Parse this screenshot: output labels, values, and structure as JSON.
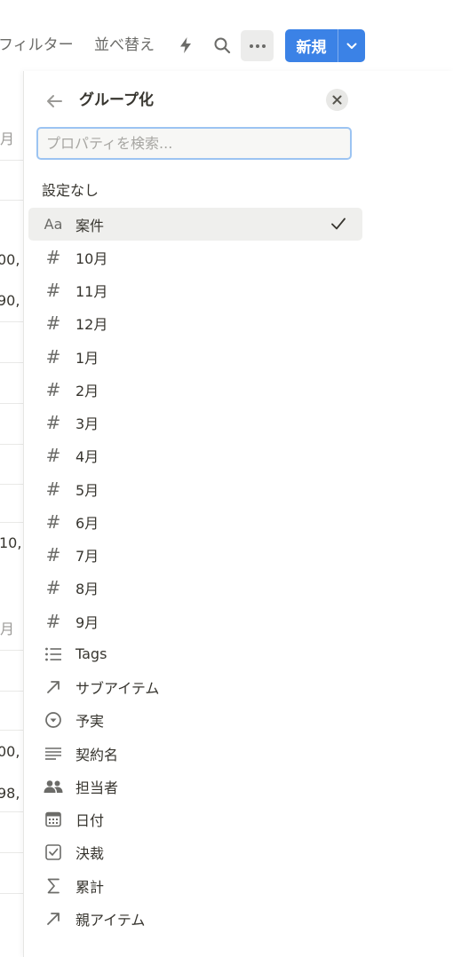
{
  "toolbar": {
    "filter_label": "フィルター",
    "sort_label": "並べ替え",
    "automation_icon": "lightning-icon",
    "search_icon": "search-icon",
    "more_icon": "more-horizontal-icon",
    "new_label": "新規",
    "new_caret_icon": "chevron-down-icon",
    "accent": "#3b82e6"
  },
  "background_table": {
    "cells": [
      "月",
      "00,",
      "90,",
      "10,",
      "月",
      "00,",
      "98,"
    ]
  },
  "panel": {
    "title": "グループ化",
    "back_icon": "arrow-left-icon",
    "close_icon": "close-icon",
    "search": {
      "placeholder": "プロパティを検索...",
      "value": ""
    },
    "section_label": "設定なし",
    "items": [
      {
        "icon": "Aa",
        "icon_name": "text-property-icon",
        "label": "案件",
        "selected": true
      },
      {
        "icon": "#",
        "icon_name": "number-property-icon",
        "label": "10月"
      },
      {
        "icon": "#",
        "icon_name": "number-property-icon",
        "label": "11月"
      },
      {
        "icon": "#",
        "icon_name": "number-property-icon",
        "label": "12月"
      },
      {
        "icon": "#",
        "icon_name": "number-property-icon",
        "label": "1月"
      },
      {
        "icon": "#",
        "icon_name": "number-property-icon",
        "label": "2月"
      },
      {
        "icon": "#",
        "icon_name": "number-property-icon",
        "label": "3月"
      },
      {
        "icon": "#",
        "icon_name": "number-property-icon",
        "label": "4月"
      },
      {
        "icon": "#",
        "icon_name": "number-property-icon",
        "label": "5月"
      },
      {
        "icon": "#",
        "icon_name": "number-property-icon",
        "label": "6月"
      },
      {
        "icon": "#",
        "icon_name": "number-property-icon",
        "label": "7月"
      },
      {
        "icon": "#",
        "icon_name": "number-property-icon",
        "label": "8月"
      },
      {
        "icon": "#",
        "icon_name": "number-property-icon",
        "label": "9月"
      },
      {
        "icon": "",
        "icon_name": "multi-select-property-icon",
        "label": "Tags"
      },
      {
        "icon": "",
        "icon_name": "relation-property-icon",
        "label": "サブアイテム"
      },
      {
        "icon": "",
        "icon_name": "select-property-icon",
        "label": "予実"
      },
      {
        "icon": "",
        "icon_name": "text-lines-property-icon",
        "label": "契約名"
      },
      {
        "icon": "",
        "icon_name": "person-property-icon",
        "label": "担当者"
      },
      {
        "icon": "",
        "icon_name": "date-property-icon",
        "label": "日付"
      },
      {
        "icon": "",
        "icon_name": "checkbox-property-icon",
        "label": "決裁"
      },
      {
        "icon": "",
        "icon_name": "formula-property-icon",
        "label": "累計"
      },
      {
        "icon": "",
        "icon_name": "relation-property-icon",
        "label": "親アイテム"
      }
    ],
    "check_icon": "checkmark-icon"
  }
}
